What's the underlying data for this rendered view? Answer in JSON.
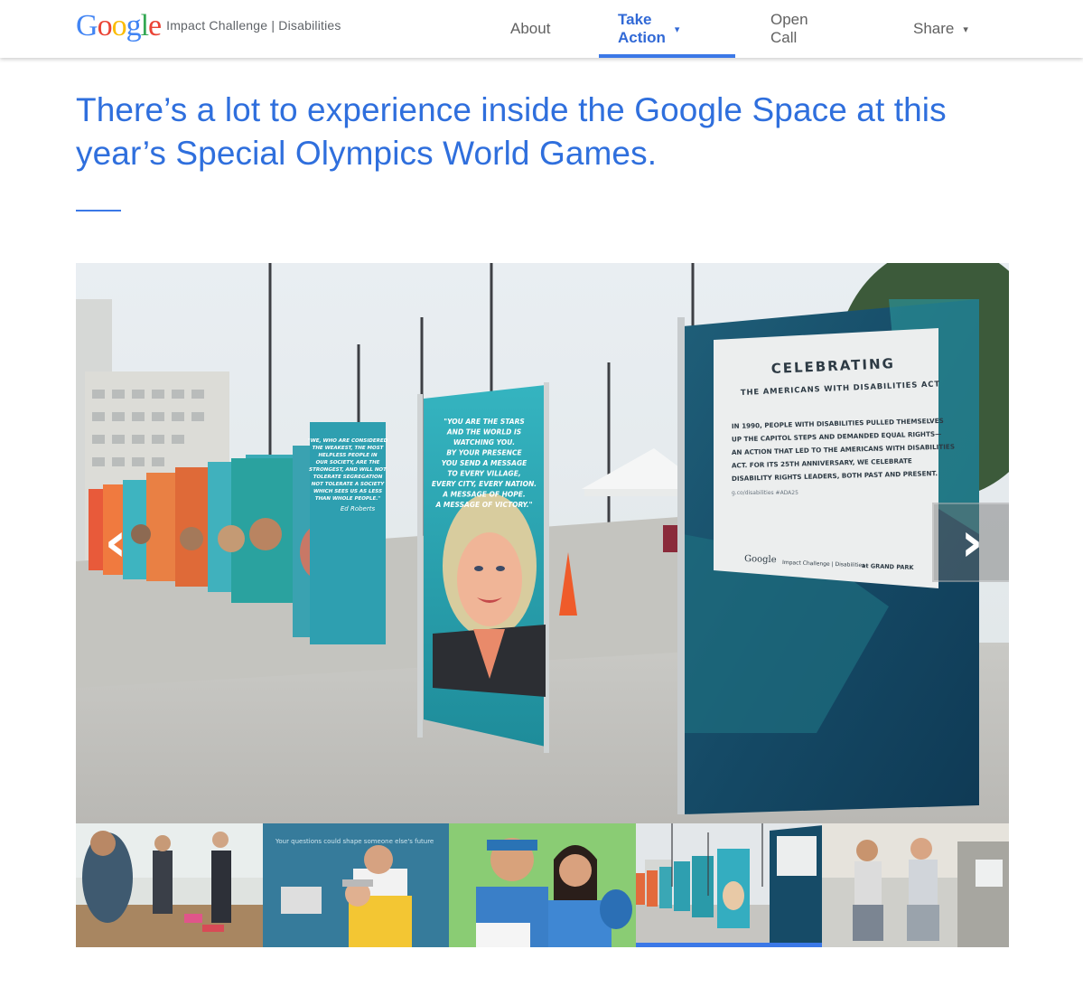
{
  "brand": {
    "logo_text": "Google",
    "subtitle": "Impact Challenge | Disabilities",
    "logo_colors": [
      "#4285F4",
      "#EA4335",
      "#FBBC05",
      "#4285F4",
      "#34A853",
      "#EA4335"
    ]
  },
  "nav": {
    "items": [
      {
        "label": "About",
        "has_dropdown": false,
        "active": false
      },
      {
        "label": "Take Action",
        "has_dropdown": true,
        "active": true
      },
      {
        "label": "Open Call",
        "has_dropdown": false,
        "active": false
      },
      {
        "label": "Share",
        "has_dropdown": true,
        "active": false
      }
    ],
    "caret": "▾"
  },
  "headline": "There’s a lot to experience inside the Google Space at this year’s Special Olympics World Games.",
  "carousel": {
    "prev_icon": "chevron-left-icon",
    "next_icon": "chevron-right-icon",
    "prev_glyph": "‹",
    "next_glyph": "›",
    "slide": {
      "panel_title": "CELEBRATING",
      "panel_subtitle": "THE AMERICANS WITH DISABILITIES ACT",
      "panel_body": [
        "IN 1990, PEOPLE WITH DISABILITIES PULLED THEMSELVES",
        "UP THE CAPITOL STEPS AND DEMANDED EQUAL RIGHTS—",
        "AN ACTION THAT LED TO THE AMERICANS WITH DISABILITIES",
        "ACT. FOR ITS 25TH ANNIVERSARY, WE CELEBRATE",
        "DISABILITY RIGHTS LEADERS, BOTH PAST AND PRESENT."
      ],
      "panel_link": "g.co/disabilities    #ADA25",
      "panel_footer_brand": "Google",
      "panel_footer_text": "Impact Challenge | Disabilities",
      "panel_footer_partner": "at GRAND PARK",
      "quote_lines": [
        "\"YOU ARE THE STARS",
        "AND THE WORLD IS",
        "WATCHING YOU.",
        "BY YOUR PRESENCE",
        "YOU SEND A MESSAGE",
        "TO EVERY VILLAGE,",
        "EVERY CITY, EVERY NATION.",
        "A MESSAGE OF HOPE.",
        "A MESSAGE OF VICTORY.\""
      ],
      "quote2_lines": [
        "\"WE, WHO ARE CONSIDERED",
        "THE WEAKEST, THE MOST",
        "HELPLESS PEOPLE IN",
        "OUR SOCIETY, ARE THE",
        "STRONGEST, AND WILL NOT",
        "TOLERATE SEGREGATION",
        "NOT TOLERATE A SOCIETY",
        "WHICH SEES US AS LESS",
        "THAN WHOLE PEOPLE.\""
      ],
      "quote2_author": "Ed Roberts"
    }
  },
  "thumbnails": [
    {
      "label": "thumb-1",
      "active": false
    },
    {
      "label": "thumb-2",
      "active": false,
      "caption": "Your questions could shape someone else's future"
    },
    {
      "label": "thumb-3",
      "active": false
    },
    {
      "label": "thumb-4",
      "active": true
    },
    {
      "label": "thumb-5",
      "active": false
    }
  ]
}
